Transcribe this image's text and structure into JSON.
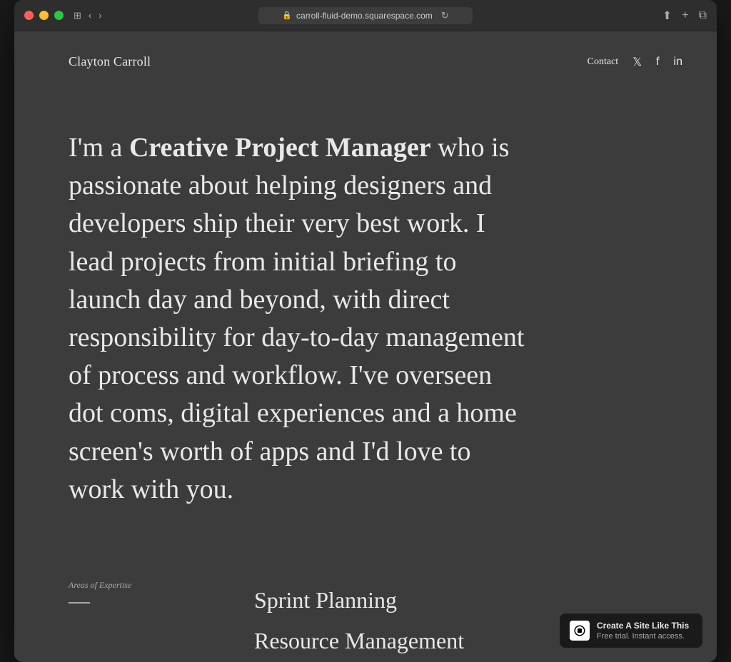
{
  "window": {
    "url": "carroll-fluid-demo.squarespace.com"
  },
  "site": {
    "logo": "Clayton Carroll",
    "nav": {
      "contact_label": "Contact",
      "twitter_label": "𝕏",
      "facebook_label": "f",
      "linkedin_label": "in"
    },
    "hero": {
      "text_before_bold": "I'm a ",
      "bold_text": "Creative Project Manager",
      "text_after": " who is passionate about helping designers and developers ship their very best work. I lead projects from initial briefing to launch day and beyond, with direct responsibility for day-to-day management of process and workflow. I've overseen dot coms, digital experiences and a home screen's worth of apps and I'd love to work with you."
    },
    "expertise": {
      "section_label": "Areas of Expertise",
      "items": [
        "Sprint Planning",
        "Resource Management"
      ]
    },
    "badge": {
      "title": "Create A Site Like This",
      "subtitle": "Free trial. Instant access."
    }
  }
}
